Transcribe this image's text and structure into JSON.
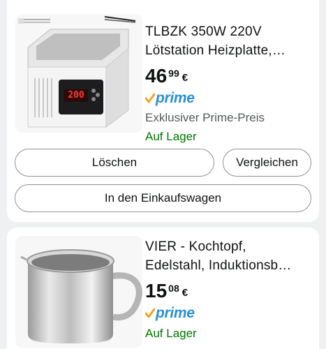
{
  "items": [
    {
      "title_line1": "TLBZK 350W 220V",
      "title_line2": "Lötstation Heizplatte,…",
      "price_whole": "46",
      "price_fraction": "99",
      "currency": "€",
      "prime_label": "prime",
      "exclusive_label": "Exklusiver Prime-Preis",
      "stock_label": "Auf Lager",
      "display_readout": "200",
      "buttons": {
        "delete": "Löschen",
        "compare": "Vergleichen",
        "add_to_cart": "In den Einkaufswagen"
      }
    },
    {
      "title_line1": "VIER - Kochtopf,",
      "title_line2": "Edelstahl, Induktionsb…",
      "price_whole": "15",
      "price_fraction": "08",
      "currency": "€",
      "prime_label": "prime",
      "stock_label": "Auf Lager"
    }
  ],
  "colors": {
    "prime_check": "#f7a21c",
    "prime_blue": "#2a8fd6",
    "in_stock_green": "#007600",
    "secondary_text": "#565959"
  }
}
